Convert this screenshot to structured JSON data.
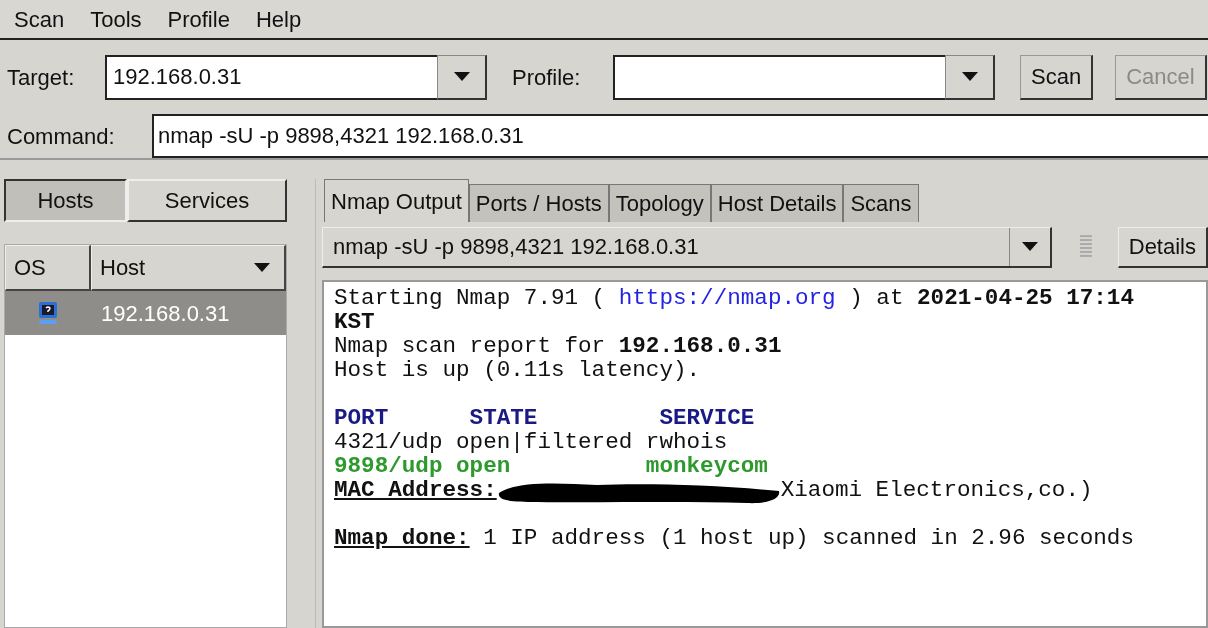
{
  "menu": [
    "Scan",
    "Tools",
    "Profile",
    "Help"
  ],
  "target": {
    "label": "Target:",
    "value": "192.168.0.31"
  },
  "profile": {
    "label": "Profile:"
  },
  "buttons": [
    {
      "label": "Scan",
      "disabled": false
    },
    {
      "label": "Cancel",
      "disabled": true
    }
  ],
  "command": {
    "label": "Command:",
    "value": "nmap -sU -p 9898,4321 192.168.0.31"
  },
  "view_toggle": [
    {
      "label": "Hosts",
      "selected": true
    },
    {
      "label": "Services",
      "selected": false
    }
  ],
  "host_table": {
    "columns": [
      "OS",
      "Host"
    ],
    "rows": [
      {
        "host": "192.168.0.31",
        "selected": true
      }
    ]
  },
  "tabs": [
    {
      "label": "Nmap Output",
      "selected": true
    },
    {
      "label": "Ports / Hosts",
      "selected": false
    },
    {
      "label": "Topology",
      "selected": false
    },
    {
      "label": "Host Details",
      "selected": false
    },
    {
      "label": "Scans",
      "selected": false
    }
  ],
  "scan_select": {
    "value": "nmap -sU -p 9898,4321 192.168.0.31"
  },
  "details_button": "Details",
  "output": {
    "lines": [
      {
        "kind": "text",
        "segments": [
          {
            "kind": "plain",
            "text": "Starting Nmap 7.91 ( "
          },
          {
            "kind": "link",
            "text": "https://nmap.org"
          },
          {
            "kind": "plain",
            "text": " ) at "
          },
          {
            "kind": "bold",
            "text": "2021-04-25 17:14 KST"
          }
        ]
      },
      {
        "kind": "text",
        "segments": [
          {
            "kind": "plain",
            "text": "Nmap scan report for "
          },
          {
            "kind": "bold",
            "text": "192.168.0.31"
          }
        ]
      },
      {
        "kind": "text",
        "segments": [
          {
            "kind": "plain",
            "text": "Host is up (0.11s latency)."
          }
        ]
      },
      {
        "kind": "blank"
      },
      {
        "kind": "text",
        "segments": [
          {
            "kind": "header",
            "text": "PORT      STATE         SERVICE"
          }
        ]
      },
      {
        "kind": "text",
        "segments": [
          {
            "kind": "plain",
            "text": "4321/udp open|filtered rwhois"
          }
        ]
      },
      {
        "kind": "text",
        "segments": [
          {
            "kind": "open",
            "text": "9898/udp open          monkeycom"
          }
        ]
      },
      {
        "kind": "text",
        "segments": [
          {
            "kind": "underline",
            "text": "MAC Address:"
          },
          {
            "kind": "redaction"
          },
          {
            "kind": "plain",
            "text": "Xiaomi Electronics,co.)"
          }
        ]
      },
      {
        "kind": "blank"
      },
      {
        "kind": "text",
        "segments": [
          {
            "kind": "underline",
            "text": "Nmap done:"
          },
          {
            "kind": "plain",
            "text": " 1 IP address (1 host up) scanned in 2.96 seconds"
          }
        ]
      }
    ]
  }
}
